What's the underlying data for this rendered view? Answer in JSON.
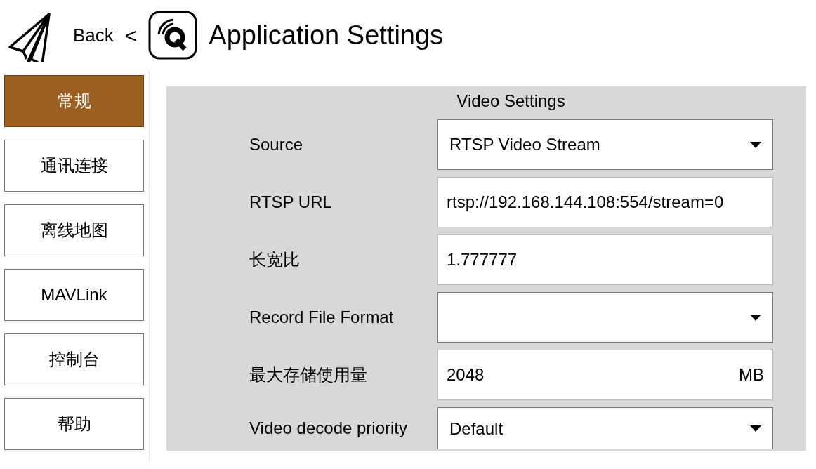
{
  "header": {
    "back_label": "Back",
    "separator": "<",
    "title": "Application Settings"
  },
  "sidebar": {
    "items": [
      {
        "label": "常规",
        "selected": true
      },
      {
        "label": "通讯连接",
        "selected": false
      },
      {
        "label": "离线地图",
        "selected": false
      },
      {
        "label": "MAVLink",
        "selected": false
      },
      {
        "label": "控制台",
        "selected": false
      },
      {
        "label": "帮助",
        "selected": false
      }
    ]
  },
  "panel": {
    "title": "Video Settings",
    "rows": [
      {
        "kind": "select",
        "label": "Source",
        "value": "RTSP Video Stream"
      },
      {
        "kind": "text",
        "label": "RTSP URL",
        "value": "rtsp://192.168.144.108:554/stream=0"
      },
      {
        "kind": "text",
        "label": "长宽比",
        "value": "1.777777"
      },
      {
        "kind": "select",
        "label": "Record File Format"
      },
      {
        "kind": "text",
        "label": "最大存储使用量",
        "value": "2048",
        "unit": "MB"
      },
      {
        "kind": "select",
        "label": "Video decode priority",
        "value": "Default"
      }
    ]
  }
}
